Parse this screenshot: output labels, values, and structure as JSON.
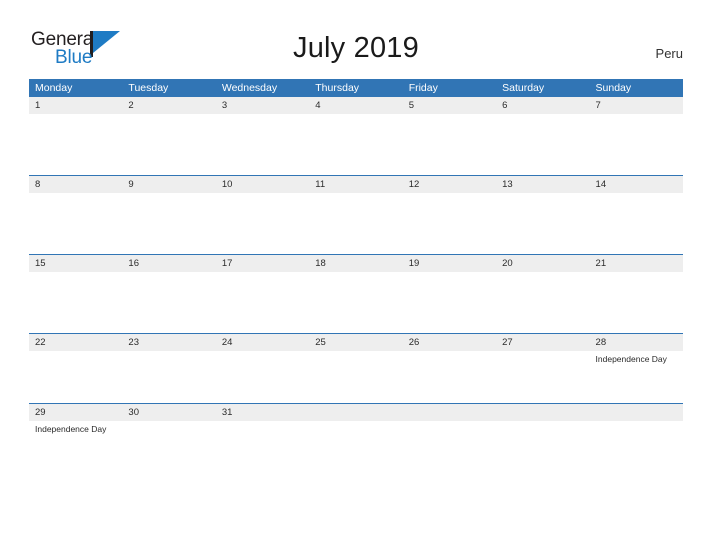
{
  "brand": {
    "name_part1": "General",
    "name_part2": "Blue",
    "flag_icon": "flag-icon",
    "accent_color": "#1e7bc4"
  },
  "header": {
    "title": "July 2019",
    "country": "Peru"
  },
  "calendar": {
    "header_bg_color": "#3175b5",
    "date_band_color": "#eeeeee",
    "separator_color": "#3175b5",
    "weekdays": [
      "Monday",
      "Tuesday",
      "Wednesday",
      "Thursday",
      "Friday",
      "Saturday",
      "Sunday"
    ],
    "weeks": [
      {
        "dates": [
          "1",
          "2",
          "3",
          "4",
          "5",
          "6",
          "7"
        ],
        "events": [
          "",
          "",
          "",
          "",
          "",
          "",
          ""
        ]
      },
      {
        "dates": [
          "8",
          "9",
          "10",
          "11",
          "12",
          "13",
          "14"
        ],
        "events": [
          "",
          "",
          "",
          "",
          "",
          "",
          ""
        ]
      },
      {
        "dates": [
          "15",
          "16",
          "17",
          "18",
          "19",
          "20",
          "21"
        ],
        "events": [
          "",
          "",
          "",
          "",
          "",
          "",
          ""
        ]
      },
      {
        "dates": [
          "22",
          "23",
          "24",
          "25",
          "26",
          "27",
          "28"
        ],
        "events": [
          "",
          "",
          "",
          "",
          "",
          "",
          "Independence Day"
        ]
      },
      {
        "dates": [
          "29",
          "30",
          "31",
          "",
          "",
          "",
          ""
        ],
        "events": [
          "Independence Day",
          "",
          "",
          "",
          "",
          "",
          ""
        ]
      }
    ]
  }
}
